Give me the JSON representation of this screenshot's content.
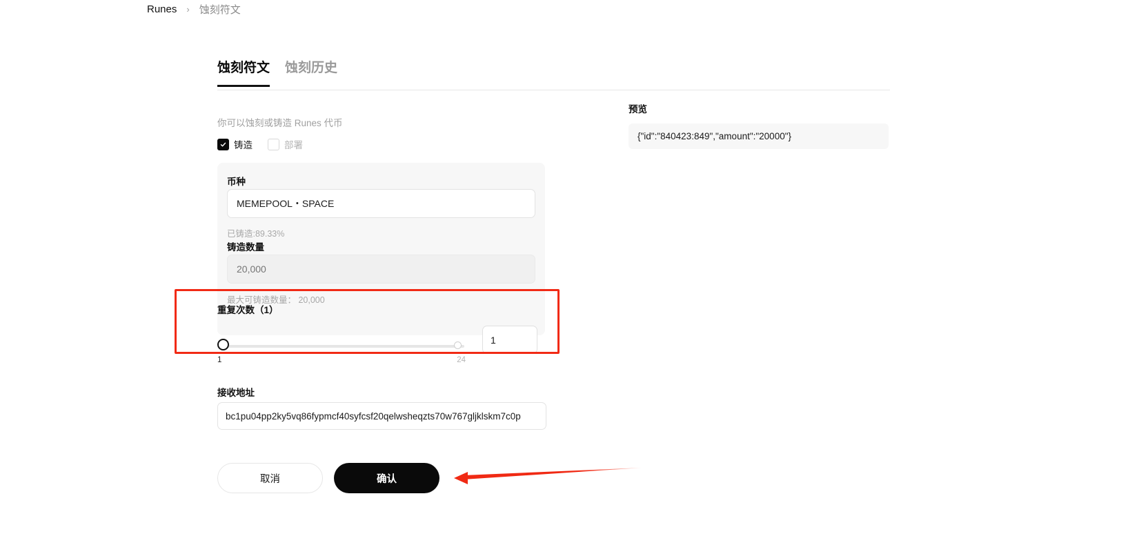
{
  "breadcrumb": {
    "root": "Runes",
    "separator": "›",
    "current": "蚀刻符文"
  },
  "tabs": [
    {
      "label": "蚀刻符文",
      "active": true
    },
    {
      "label": "蚀刻历史",
      "active": false
    }
  ],
  "form": {
    "description": "你可以蚀刻或铸造 Runes 代币",
    "mode_options": [
      {
        "label": "铸造",
        "checked": true
      },
      {
        "label": "部署",
        "checked": false
      }
    ],
    "coin": {
      "label": "币种",
      "value": "MEMEPOOL・SPACE",
      "minted_hint": "已铸造:89.33%"
    },
    "amount": {
      "label": "铸造数量",
      "placeholder": "20,000",
      "value": "",
      "max_hint": "最大可铸造数量： 20,000"
    },
    "repeat": {
      "label": "重复次数（1）",
      "value": "1",
      "min": "1",
      "max": "24",
      "highlight_color": "#f12a15"
    },
    "address": {
      "label": "接收地址",
      "value": "bc1pu04pp2ky5vq86fypmcf40syfcsf20qelwsheqzts70w767gljklskm7c0p"
    },
    "actions": {
      "cancel": "取消",
      "confirm": "确认"
    }
  },
  "preview": {
    "title": "预览",
    "json": "{\"id\":\"840423:849\",\"amount\":\"20000\"}"
  },
  "annotation": {
    "arrow_color": "#f02a14"
  }
}
